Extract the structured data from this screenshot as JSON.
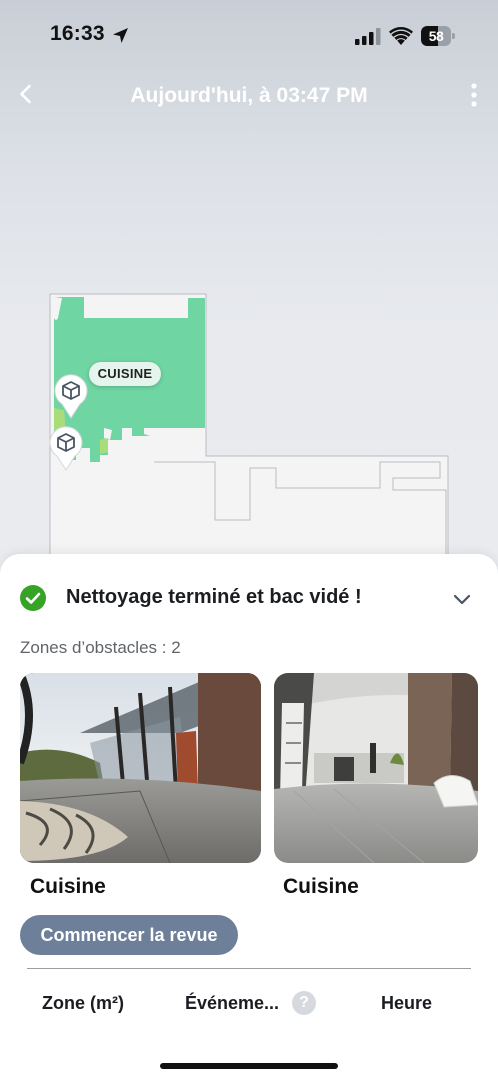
{
  "status_bar": {
    "time": "16:33",
    "battery": "58",
    "battery_level": 0.58
  },
  "nav": {
    "title": "Aujourd'hui, à 03:47 PM"
  },
  "map": {
    "room_label": "CUISINE",
    "room_color": "#6fd5a3",
    "obstacle_pins": 2
  },
  "result": {
    "title": "Nettoyage terminé et bac vidé !",
    "obstacle_zones": "Zones d’obstacles : 2",
    "status_color": "#36a327"
  },
  "obstacles": [
    {
      "caption": "Cuisine"
    },
    {
      "caption": "Cuisine"
    }
  ],
  "actions": {
    "review_label": "Commencer la revue"
  },
  "columns": {
    "zone": "Zone (m²)",
    "events": "Événeme...",
    "help": "?",
    "time": "Heure"
  },
  "colors": {
    "review_button": "#6e7f99",
    "map_floor": "#f4f4f5",
    "map_wall": "#b9bcc1"
  }
}
